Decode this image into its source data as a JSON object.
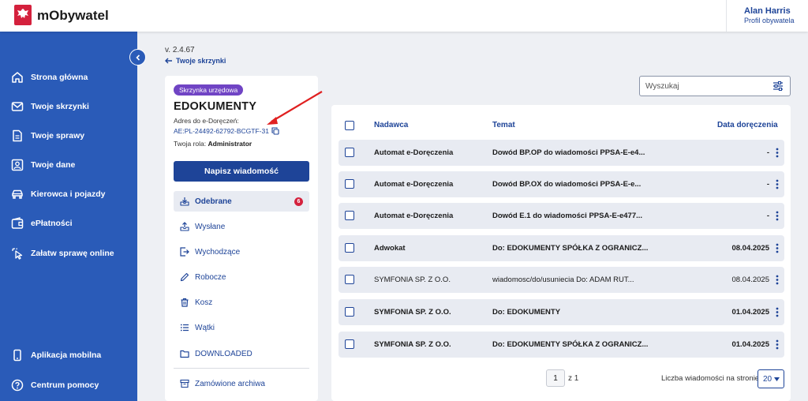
{
  "app": {
    "name": "mObywatel"
  },
  "user": {
    "name": "Alan Harris",
    "profile": "Profil obywatela"
  },
  "sidebar": {
    "items": [
      {
        "label": "Strona główna",
        "icon": "home-icon"
      },
      {
        "label": "Twoje skrzynki",
        "icon": "mail-icon"
      },
      {
        "label": "Twoje sprawy",
        "icon": "document-icon"
      },
      {
        "label": "Twoje dane",
        "icon": "id-card-icon"
      },
      {
        "label": "Kierowca i pojazdy",
        "icon": "car-icon"
      },
      {
        "label": "ePłatności",
        "icon": "wallet-icon"
      },
      {
        "label": "Załatw sprawę online",
        "icon": "pointer-click-icon"
      }
    ],
    "bottom_items": [
      {
        "label": "Aplikacja mobilna",
        "icon": "phone-icon"
      },
      {
        "label": "Centrum pomocy",
        "icon": "help-icon"
      }
    ]
  },
  "header": {
    "version": "v. 2.4.67",
    "back_link": "Twoje skrzynki"
  },
  "mailbox": {
    "type_badge": "Skrzynka urzędowa",
    "title": "EDOKUMENTY",
    "address_label": "Adres do e-Doręczeń:",
    "address": "AE:PL-24492-62792-BCGTF-31",
    "role_label": "Twoja rola:",
    "role": "Administrator",
    "compose_label": "Napisz wiadomość",
    "folders": [
      {
        "label": "Odebrane",
        "icon": "inbox-icon",
        "count": "6"
      },
      {
        "label": "Wysłane",
        "icon": "outbox-icon"
      },
      {
        "label": "Wychodzące",
        "icon": "exit-icon"
      },
      {
        "label": "Robocze",
        "icon": "pencil-icon"
      },
      {
        "label": "Kosz",
        "icon": "trash-icon"
      },
      {
        "label": "Wątki",
        "icon": "list-icon"
      },
      {
        "label": "DOWNLOADED",
        "icon": "folder-icon"
      }
    ],
    "archive_label": "Zamówione archiwa"
  },
  "search": {
    "placeholder": "Wyszukaj"
  },
  "table": {
    "columns": {
      "sender": "Nadawca",
      "subject": "Temat",
      "date": "Data doręczenia"
    },
    "rows": [
      {
        "sender": "Automat e-Doręczenia",
        "subject": "Dowód BP.OP do wiadomości PPSA-E-e4...",
        "date": "-",
        "unread": true
      },
      {
        "sender": "Automat e-Doręczenia",
        "subject": "Dowód BP.OX do wiadomości PPSA-E-e...",
        "date": "-",
        "unread": true
      },
      {
        "sender": "Automat e-Doręczenia",
        "subject": "Dowód E.1 do wiadomości PPSA-E-e477...",
        "date": "-",
        "unread": true
      },
      {
        "sender": "Adwokat",
        "subject": "Do: EDOKUMENTY SPÓŁKA Z OGRANICZ...",
        "date": "08.04.2025",
        "unread": true
      },
      {
        "sender": "SYMFONIA SP. Z O.O.",
        "subject": "wiadomosc/do/usuniecia Do: ADAM RUT...",
        "date": "08.04.2025",
        "unread": false
      },
      {
        "sender": "SYMFONIA SP. Z O.O.",
        "subject": "Do: EDOKUMENTY",
        "date": "01.04.2025",
        "unread": true
      },
      {
        "sender": "SYMFONIA SP. Z O.O.",
        "subject": "Do: EDOKUMENTY SPÓŁKA Z OGRANICZ...",
        "date": "01.04.2025",
        "unread": true
      }
    ]
  },
  "pagination": {
    "current_page": "1",
    "of_label": "z 1",
    "per_page_label": "Liczba wiadomości na stronie",
    "per_page": "20"
  },
  "colors": {
    "primary": "#1e4498",
    "sidebar": "#2a5bb8",
    "badge": "#7044c4",
    "alert": "#d4213d"
  }
}
